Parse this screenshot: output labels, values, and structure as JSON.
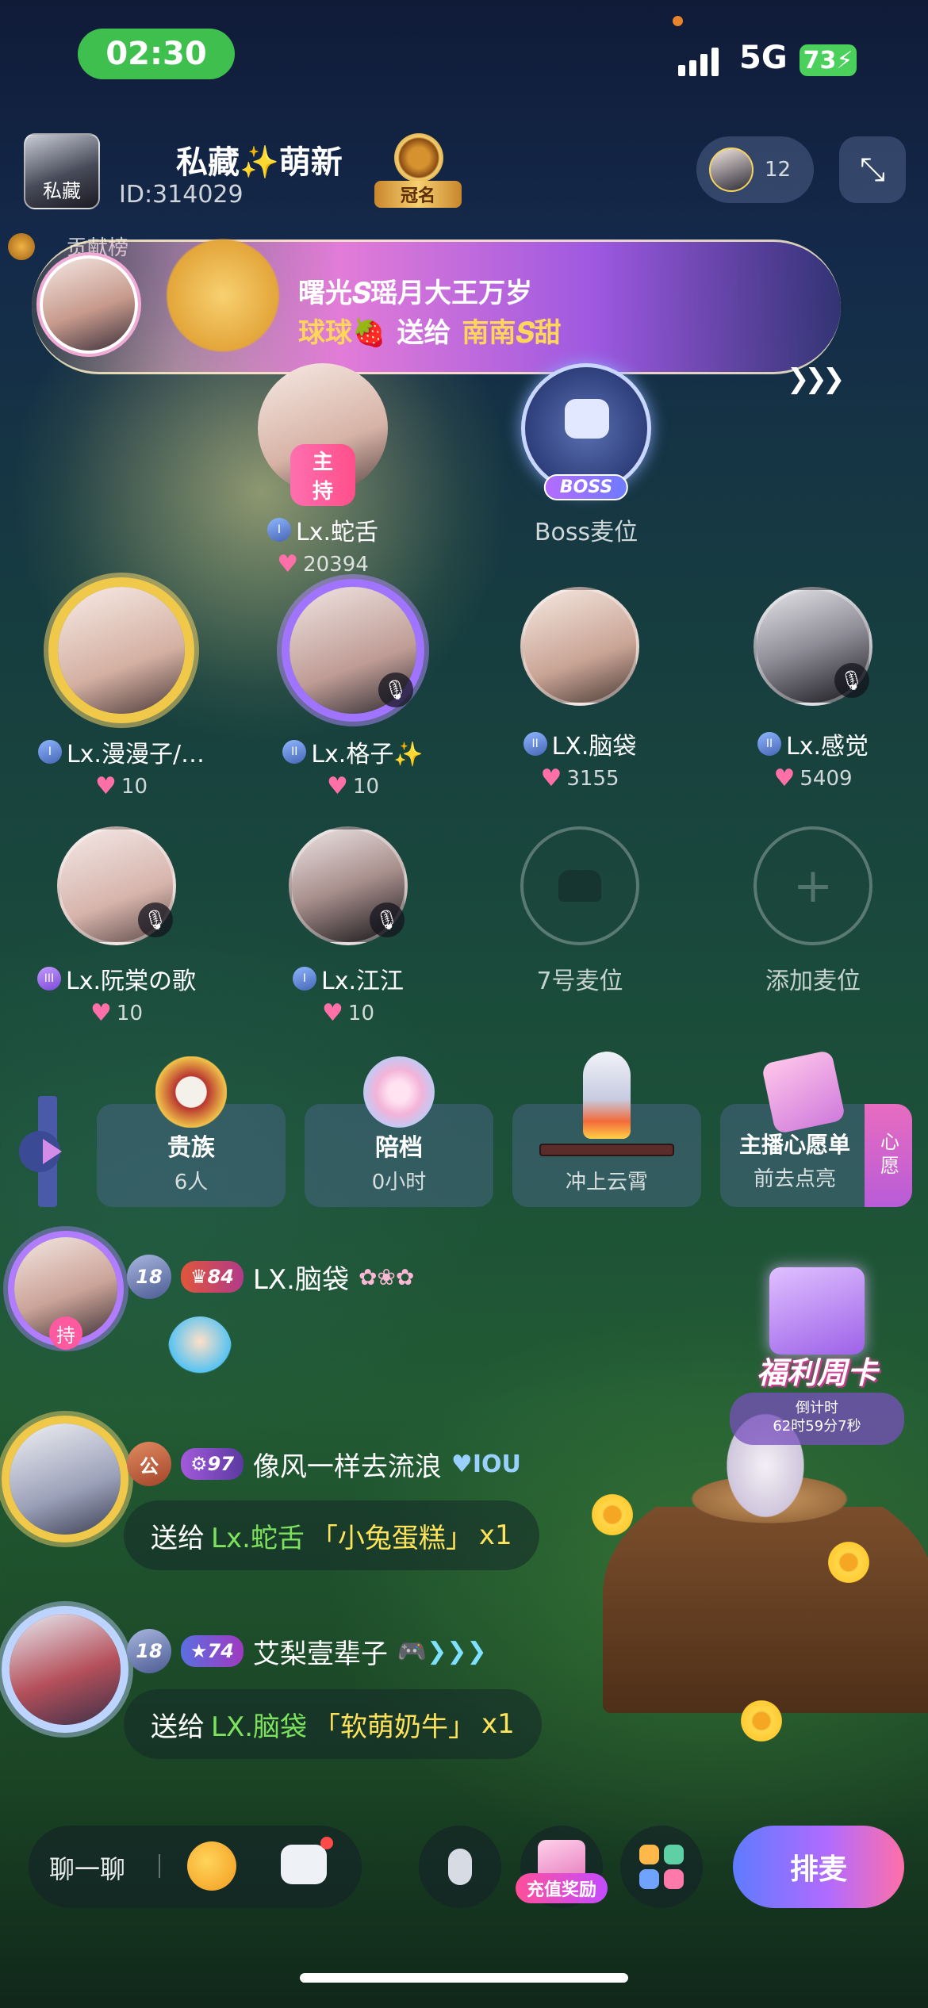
{
  "status_bar": {
    "time": "02:30",
    "network": "5G",
    "battery": "73"
  },
  "room": {
    "name": "私藏✨萌新",
    "id": "ID:314029",
    "crown_label": "冠名",
    "avatar_text": "私藏",
    "online_count": "12"
  },
  "contribution": {
    "label": "贡献榜"
  },
  "gift_banner": {
    "line1": "曙光𝑺瑶月大王万岁",
    "sender": "球球🍓",
    "action": "送给",
    "receiver": "南南𝑺甜"
  },
  "host_seat": {
    "tag": "主持",
    "name": "Lx.蛇舌",
    "hearts": "20394"
  },
  "boss_seat": {
    "tag": "BOSS",
    "name": "Boss麦位"
  },
  "seats": [
    {
      "name": "Lx.漫漫子/…",
      "hearts": "10"
    },
    {
      "name": "Lx.格子✨",
      "hearts": "10"
    },
    {
      "name": "LX.脑袋",
      "hearts": "3155"
    },
    {
      "name": "Lx.感觉",
      "hearts": "5409"
    },
    {
      "name": "Lx.阮棠の歌",
      "hearts": "10"
    },
    {
      "name": "Lx.江江",
      "hearts": "10"
    },
    {
      "name": "7号麦位"
    },
    {
      "name": "添加麦位"
    }
  ],
  "functions": [
    {
      "title": "贵族",
      "sub": "6人"
    },
    {
      "title": "陪档",
      "sub": "0小时"
    },
    {
      "title": "",
      "sub": "冲上云霄"
    },
    {
      "title": "主播心愿单",
      "sub": "前去点亮",
      "tab": "心愿"
    }
  ],
  "chat": [
    {
      "badge_level": "18",
      "badge_rank": "84",
      "user": "LX.脑袋",
      "avatar_tag": "持"
    },
    {
      "badge_public": "公",
      "badge_rank": "97",
      "user": "像风一样去流浪",
      "gift_prefix": "送给",
      "gift_target": "Lx.蛇舌",
      "gift_item": "「小兔蛋糕」",
      "gift_count": "x1"
    },
    {
      "badge_level": "18",
      "badge_rank": "74",
      "user": "艾梨壹辈子",
      "gift_prefix": "送给",
      "gift_target": "LX.脑袋",
      "gift_item": "「软萌奶牛」",
      "gift_count": "x1"
    }
  ],
  "promo": {
    "title": "福利周卡",
    "countdown_label": "倒计时",
    "countdown": "62时59分7秒"
  },
  "bottom_bar": {
    "chat_placeholder": "聊一聊",
    "recharge_label": "充值奖励",
    "queue_label": "排麦"
  },
  "colors": {
    "green_text": "#7de35d",
    "gold_text": "#ffe35a",
    "time_pill": "#3fbf4e",
    "queue_start": "#5f7bff",
    "queue_end": "#ff6fa8"
  }
}
